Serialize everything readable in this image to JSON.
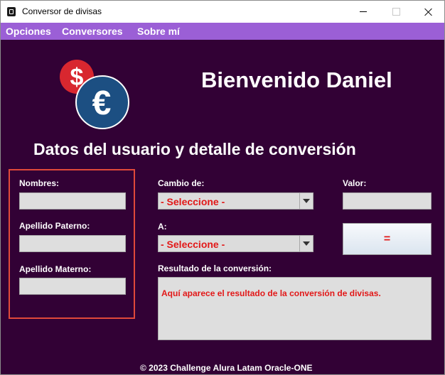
{
  "window": {
    "title": "Conversor de divisas"
  },
  "menu": {
    "items": [
      {
        "label": "Opciones"
      },
      {
        "label": "Conversores"
      },
      {
        "label": "Sobre mí"
      }
    ]
  },
  "header": {
    "welcome": "Bienvenido Daniel",
    "logo_dollar": "$",
    "logo_euro": "€"
  },
  "section_title": "Datos del usuario y detalle de conversión",
  "user": {
    "nombres_label": "Nombres:",
    "nombres_value": "",
    "apellido_paterno_label": "Apellido Paterno:",
    "apellido_paterno_value": "",
    "apellido_materno_label": "Apellido Materno:",
    "apellido_materno_value": ""
  },
  "conversion": {
    "cambio_label": "Cambio de:",
    "cambio_selected": "- Seleccione -",
    "a_label": "A:",
    "a_selected": "- Seleccione -",
    "valor_label": "Valor:",
    "valor_value": "",
    "equals_label": "=",
    "resultado_label": "Resultado de la conversión:",
    "resultado_text": "Aquí aparece el resultado de la conversión de divisas."
  },
  "footer": "© 2023 Challenge Alura Latam Oracle-ONE",
  "colors": {
    "background": "#320135",
    "menubar": "#9b5fd6",
    "accent_red": "#e21818",
    "box_border": "#e0493a",
    "dollar_coin": "#d8272f",
    "euro_coin": "#1c4f82"
  }
}
